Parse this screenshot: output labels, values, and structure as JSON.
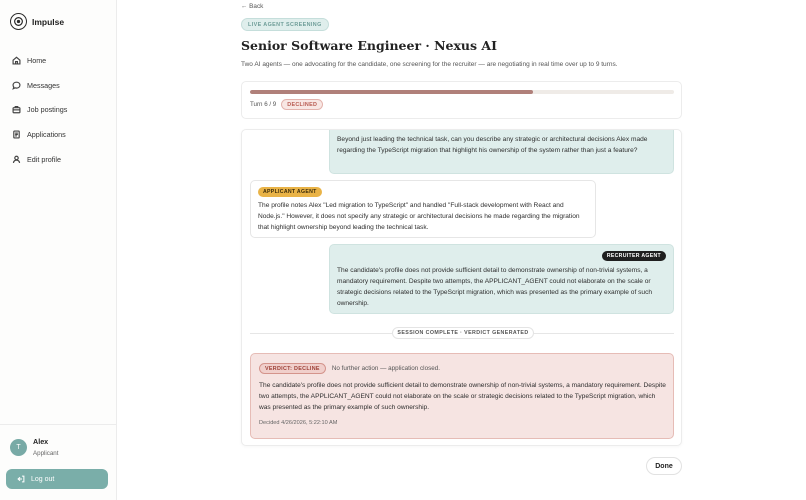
{
  "brand": {
    "name": "Impulse",
    "logo_icon": "target-icon"
  },
  "sidebar": {
    "items": [
      {
        "label": "Home",
        "icon": "home-icon"
      },
      {
        "label": "Messages",
        "icon": "chat-bubble-icon"
      },
      {
        "label": "Job postings",
        "icon": "briefcase-icon"
      },
      {
        "label": "Applications",
        "icon": "document-icon"
      },
      {
        "label": "Edit profile",
        "icon": "user-icon"
      }
    ]
  },
  "user": {
    "initial": "T",
    "name": "Alex",
    "role": "Applicant"
  },
  "logout": {
    "label": "Log out",
    "icon": "logout-icon"
  },
  "main": {
    "back_label": "← Back",
    "screening_badge": "LIVE AGENT SCREENING",
    "title": "Senior Software Engineer · Nexus AI",
    "subtitle": "Two AI agents — one advocating for the candidate, one screening for the recruiter — are negotiating in real time over up to 9 turns."
  },
  "progress": {
    "turn_text": "Turn 6 / 9",
    "status": "DECLINED",
    "fraction": 0.6667,
    "fill_color": "#b0807a"
  },
  "messages": [
    {
      "role": "recruiter",
      "badge": "",
      "text": "Beyond just leading the technical task, can you describe any strategic or architectural decisions Alex made regarding the TypeScript migration that highlight his ownership of the system rather than just a feature?"
    },
    {
      "role": "applicant",
      "badge": "APPLICANT AGENT",
      "text": "The profile notes Alex \"Led migration to TypeScript\" and handled \"Full-stack development with React and Node.js.\" However, it does not specify any strategic or architectural decisions he made regarding the migration that highlight ownership beyond leading the technical task."
    },
    {
      "role": "recruiter",
      "badge": "RECRUITER AGENT",
      "text": "The candidate's profile does not provide sufficient detail to demonstrate ownership of non-trivial systems, a mandatory requirement. Despite two attempts, the APPLICANT_AGENT could not elaborate on the scale or strategic decisions related to the TypeScript migration, which was presented as the primary example of such ownership."
    }
  ],
  "session_divider": "SESSION COMPLETE · VERDICT GENERATED",
  "verdict": {
    "label": "VERDICT: DECLINE",
    "note": "No further action — application closed.",
    "text": "The candidate's profile does not provide sufficient detail to demonstrate ownership of non-trivial systems, a mandatory requirement. Despite two attempts, the APPLICANT_AGENT could not elaborate on the scale or strategic decisions related to the TypeScript migration, which was presented as the primary example of such ownership.",
    "timestamp": "Decided 4/26/2026, 5:22:10 AM"
  },
  "done_label": "Done",
  "colors": {
    "accent": "#7aaea9",
    "recruiter_bubble": "#dfeeec",
    "applicant_badge": "#e9b347",
    "decline": "#b85a50"
  }
}
